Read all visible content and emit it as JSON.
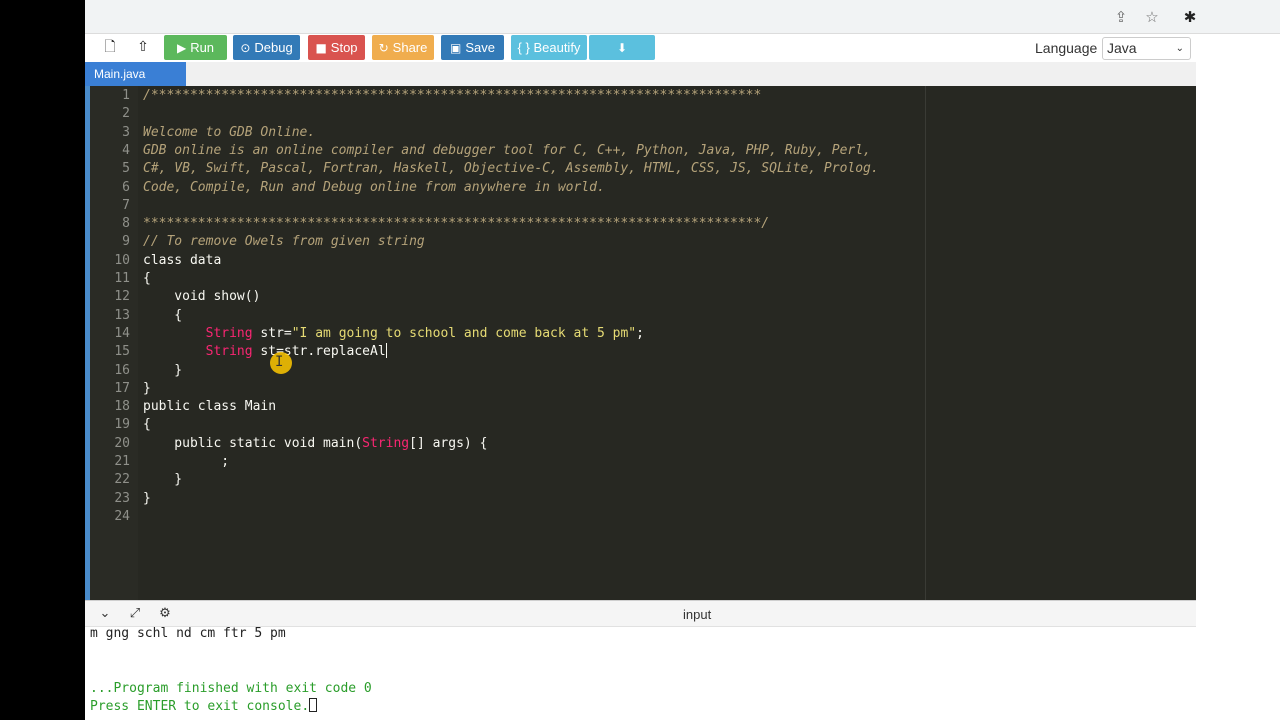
{
  "toolbar": {
    "new_file_icon": "file-icon",
    "upload_icon": "upload-icon",
    "run_label": "Run",
    "debug_label": "Debug",
    "stop_label": "Stop",
    "share_label": "Share",
    "save_label": "Save",
    "beautify_label": "{ } Beautify",
    "download_icon": "download-icon",
    "language_label": "Language",
    "language_value": "Java",
    "colors": {
      "run": "#5cb85c",
      "debug": "#337ab7",
      "stop": "#d9534f",
      "share": "#f0ad4e",
      "save": "#337ab7",
      "beautify": "#5bc0de",
      "download": "#5bc0de"
    }
  },
  "tabs": [
    {
      "label": "Main.java",
      "active": true
    }
  ],
  "editor": {
    "lines": [
      {
        "n": "1",
        "text": "/******************************************************************************"
      },
      {
        "n": "2",
        "text": ""
      },
      {
        "n": "3",
        "text": "Welcome to GDB Online."
      },
      {
        "n": "4",
        "text": "GDB online is an online compiler and debugger tool for C, C++, Python, Java, PHP, Ruby, Perl,"
      },
      {
        "n": "5",
        "text": "C#, VB, Swift, Pascal, Fortran, Haskell, Objective-C, Assembly, HTML, CSS, JS, SQLite, Prolog."
      },
      {
        "n": "6",
        "text": "Code, Compile, Run and Debug online from anywhere in world."
      },
      {
        "n": "7",
        "text": ""
      },
      {
        "n": "8",
        "text": "*******************************************************************************/"
      },
      {
        "n": "9",
        "text": "// To remove Owels from given string"
      },
      {
        "n": "10",
        "text": "class data"
      },
      {
        "n": "11",
        "text": "{"
      },
      {
        "n": "12",
        "text": "    void show()"
      },
      {
        "n": "13",
        "text": "    {"
      },
      {
        "n": "14",
        "type": "String",
        "rest_a": " str=",
        "str": "\"I am going to school and come back at 5 pm\"",
        "rest_b": ";"
      },
      {
        "n": "15",
        "type": "String",
        "rest_a": " st=str.replaceAl",
        "str": "",
        "rest_b": ""
      },
      {
        "n": "16",
        "text": "    }"
      },
      {
        "n": "17",
        "text": "}"
      },
      {
        "n": "18",
        "text": "public class Main"
      },
      {
        "n": "19",
        "text": "{"
      },
      {
        "n": "20",
        "pre": "    public static void main(",
        "type": "String",
        "post": "[] args) {"
      },
      {
        "n": "21",
        "text": "          ;"
      },
      {
        "n": "22",
        "text": "    }"
      },
      {
        "n": "23",
        "text": "}"
      },
      {
        "n": "24",
        "text": ""
      }
    ]
  },
  "console": {
    "input_label": "input",
    "output_line": "m gng schl nd cm ftr 5 pm",
    "finished_line": "...Program finished with exit code 0",
    "press_enter_line": "Press ENTER to exit console."
  }
}
